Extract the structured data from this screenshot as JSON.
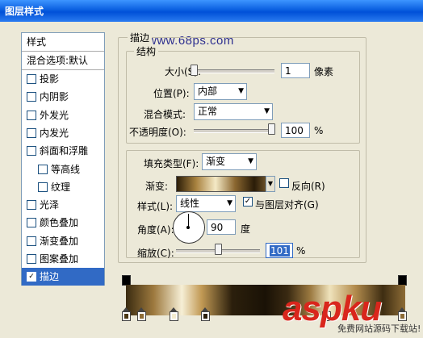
{
  "window": {
    "title": "图层样式"
  },
  "watermarks": {
    "site": "www.68ps.com",
    "aspku": "aspku",
    "aspku_sub": "免费网站源码下载站!"
  },
  "left_panel": {
    "header": "样式",
    "blend": "混合选项:默认",
    "items": [
      {
        "label": "投影",
        "checked": false,
        "indent": false
      },
      {
        "label": "内阴影",
        "checked": false,
        "indent": false
      },
      {
        "label": "外发光",
        "checked": false,
        "indent": false
      },
      {
        "label": "内发光",
        "checked": false,
        "indent": false
      },
      {
        "label": "斜面和浮雕",
        "checked": false,
        "indent": false
      },
      {
        "label": "等高线",
        "checked": false,
        "indent": true
      },
      {
        "label": "纹理",
        "checked": false,
        "indent": true
      },
      {
        "label": "光泽",
        "checked": false,
        "indent": false
      },
      {
        "label": "颜色叠加",
        "checked": false,
        "indent": false
      },
      {
        "label": "渐变叠加",
        "checked": false,
        "indent": false
      },
      {
        "label": "图案叠加",
        "checked": false,
        "indent": false
      },
      {
        "label": "描边",
        "checked": true,
        "indent": false
      }
    ]
  },
  "stroke": {
    "group_title": "描边",
    "structure_title": "结构",
    "size_label": "大小(S):",
    "size_value": "1",
    "size_unit": "像素",
    "size_level": 0.0,
    "position_label": "位置(P):",
    "position_value": "内部",
    "blend_label": "混合模式:",
    "blend_value": "正常",
    "opacity_label": "不透明度(O):",
    "opacity_value": "100",
    "opacity_unit": "%",
    "opacity_level": 1.0
  },
  "fill": {
    "type_label": "填充类型(F):",
    "type_value": "渐变",
    "gradient_label": "渐变:",
    "reverse_label": "反向(R)",
    "reverse_checked": false,
    "style_label": "样式(L):",
    "style_value": "线性",
    "align_label": "与图层对齐(G)",
    "align_checked": true,
    "angle_label": "角度(A):",
    "angle_value": "90",
    "angle_unit": "度",
    "scale_label": "缩放(C):",
    "scale_value": "101",
    "scale_unit": "%",
    "scale_level": 0.5
  },
  "icons": {
    "arrow": "▼",
    "check": "✓"
  }
}
